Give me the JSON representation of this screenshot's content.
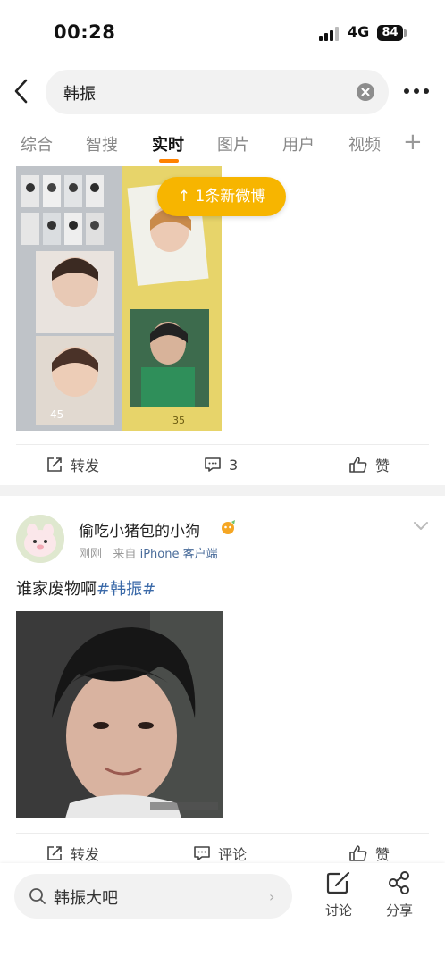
{
  "status_bar": {
    "time": "00:28",
    "network": "4G",
    "battery": "84"
  },
  "search": {
    "query": "韩振"
  },
  "tabs": [
    {
      "label": "综合",
      "active": false
    },
    {
      "label": "智搜",
      "active": false
    },
    {
      "label": "实时",
      "active": true
    },
    {
      "label": "图片",
      "active": false
    },
    {
      "label": "用户",
      "active": false
    },
    {
      "label": "视频",
      "active": false
    }
  ],
  "tabs_extra": "+",
  "new_post_pill": "↑ 1条新微博",
  "post1": {
    "repost_label": "转发",
    "comment_count": "3",
    "like_label": "赞"
  },
  "post2": {
    "username": "偷吃小猪包的小狗",
    "time": "刚刚",
    "source_prefix": "来自",
    "source": "iPhone 客户端",
    "text": "谁家废物啊",
    "topic": "#韩振#",
    "repost_label": "转发",
    "comment_label": "评论",
    "like_label": "赞"
  },
  "bottom_bar": {
    "search_text": "韩振大吧",
    "arrow": "›",
    "discuss_label": "讨论",
    "share_label": "分享"
  },
  "colors": {
    "accent": "#ff8200",
    "pill": "#f7b500",
    "link": "#3a69a8"
  }
}
